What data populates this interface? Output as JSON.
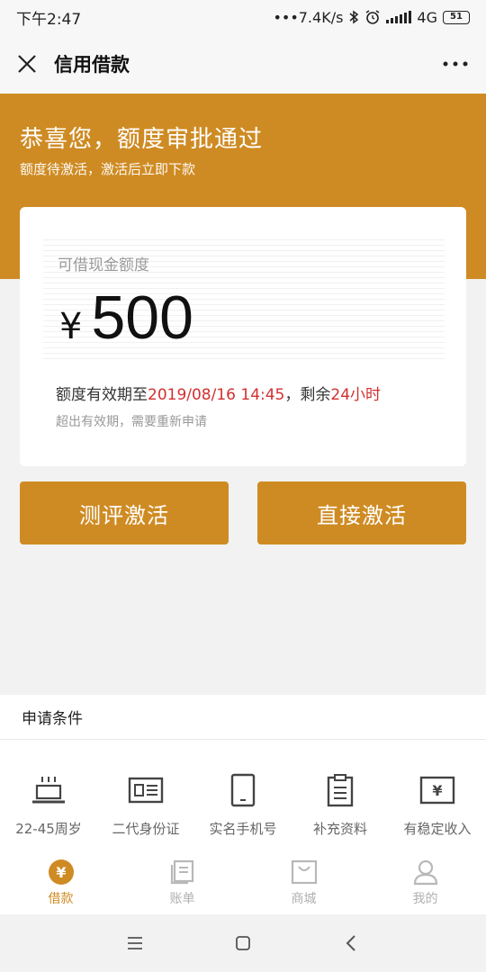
{
  "status_bar": {
    "time": "下午2:47",
    "network_speed": "•••7.4K/s",
    "network_type": "4G",
    "battery": "51"
  },
  "nav": {
    "title": "信用借款",
    "close_icon": "close-icon",
    "more_icon": "more-dots-icon"
  },
  "hero": {
    "title": "恭喜您，额度审批通过",
    "subtitle": "额度待激活，激活后立即下款",
    "background_color": "#cf8b23"
  },
  "quota": {
    "label": "可借现金额度",
    "currency": "¥",
    "amount": "500",
    "validity_prefix": "额度有效期至",
    "validity_date": "2019/08/16 14:45",
    "remaining_prefix": "，剩余",
    "remaining_time": "24小时",
    "expire_note": "超出有效期，需要重新申请",
    "highlight_color": "#d32f2f"
  },
  "actions": {
    "evaluate_label": "测评激活",
    "direct_label": "直接激活"
  },
  "conditions": {
    "title": "申请条件",
    "items": [
      {
        "icon": "cake-icon",
        "label": "22-45周岁"
      },
      {
        "icon": "id-card-icon",
        "label": "二代身份证"
      },
      {
        "icon": "phone-icon",
        "label": "实名手机号"
      },
      {
        "icon": "clipboard-icon",
        "label": "补充资料"
      },
      {
        "icon": "income-icon",
        "label": "有稳定收入"
      }
    ]
  },
  "tabbar": {
    "active": "借款",
    "items": [
      {
        "icon": "yen-coin-icon",
        "label": "借款"
      },
      {
        "icon": "bill-icon",
        "label": "账单"
      },
      {
        "icon": "shop-bag-icon",
        "label": "商城"
      },
      {
        "icon": "user-icon",
        "label": "我的"
      }
    ]
  },
  "system_nav": {
    "menu_icon": "menu-icon",
    "home_icon": "home-square-icon",
    "back_icon": "back-chevron-icon"
  }
}
